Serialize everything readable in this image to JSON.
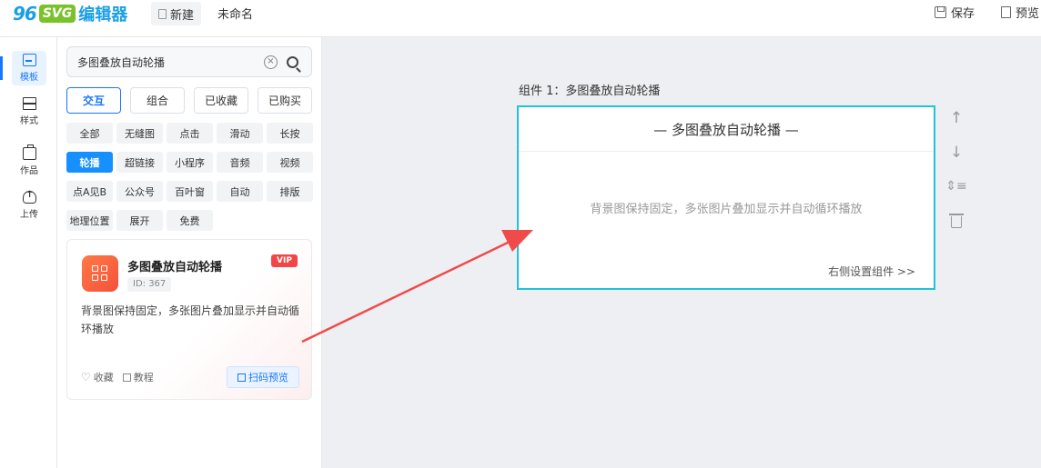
{
  "header": {
    "logo": {
      "num": "96",
      "svg": "SVG",
      "text": "编辑器"
    },
    "new_label": "新建",
    "doc_title": "未命名",
    "save_label": "保存",
    "preview_label": "预览"
  },
  "leftnav": {
    "items": [
      {
        "label": "模板",
        "icon": "template-icon",
        "active": true
      },
      {
        "label": "样式",
        "icon": "style-icon"
      },
      {
        "label": "作品",
        "icon": "works-icon"
      },
      {
        "label": "上传",
        "icon": "upload-icon"
      }
    ]
  },
  "search": {
    "value": "多图叠放自动轮播",
    "clear": "×"
  },
  "main_tabs": [
    "交互",
    "组合",
    "已收藏",
    "已购买"
  ],
  "active_main_tab": "交互",
  "tags": [
    "全部",
    "无缝图",
    "点击",
    "滑动",
    "长按",
    "轮播",
    "超链接",
    "小程序",
    "音频",
    "视频",
    "点A见B",
    "公众号",
    "百叶窗",
    "自动",
    "排版",
    "地理位置",
    "展开",
    "免费"
  ],
  "active_tag": "轮播",
  "card": {
    "title": "多图叠放自动轮播",
    "id": "ID: 367",
    "badge": "VIP",
    "description": "背景图保持固定，多张图片叠加显示并自动循环播放",
    "favorite": "收藏",
    "tutorial": "教程",
    "qr_preview": "扫码预览"
  },
  "canvas": {
    "component_label": "组件 1：多图叠放自动轮播",
    "component_title": "— 多图叠放自动轮播 —",
    "component_desc": "背景图保持固定，多张图片叠加显示并自动循环播放",
    "settings_link": "右侧设置组件 >>",
    "tools": {
      "up": "↑",
      "down": "↓",
      "spacing": "⇕≡"
    }
  },
  "colors": {
    "accent": "#1677ff",
    "component_border": "#20c3d8",
    "arrow": "#f04b4b",
    "vip": "#f04646"
  }
}
